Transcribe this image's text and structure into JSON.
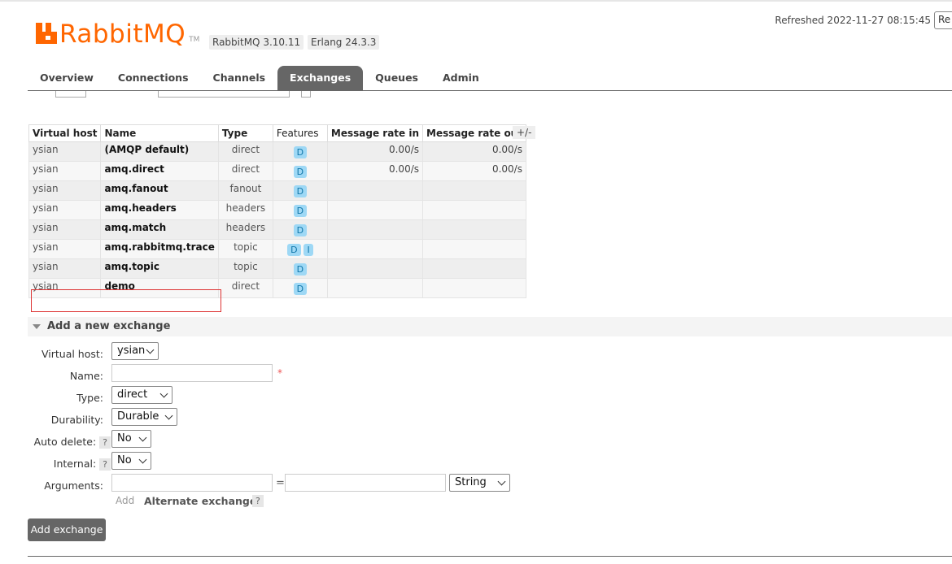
{
  "header": {
    "logo_text": "RabbitMQ",
    "logo_tm": "TM",
    "rabbitmq_version": "RabbitMQ 3.10.11",
    "erlang_version": "Erlang 24.3.3",
    "refreshed": "Refreshed 2022-11-27 08:15:45",
    "refresh_button": "Re",
    "brand_color": "#ff6600"
  },
  "tabs": [
    {
      "label": "Overview"
    },
    {
      "label": "Connections"
    },
    {
      "label": "Channels"
    },
    {
      "label": "Exchanges",
      "active": true
    },
    {
      "label": "Queues"
    },
    {
      "label": "Admin"
    }
  ],
  "table": {
    "columns": [
      "Virtual host",
      "Name",
      "Type",
      "Features",
      "Message rate in",
      "Message rate out"
    ],
    "toggle_columns": "+/-",
    "rows": [
      {
        "vhost": "ysian",
        "name": "(AMQP default)",
        "type": "direct",
        "features": [
          "D"
        ],
        "rate_in": "0.00/s",
        "rate_out": "0.00/s"
      },
      {
        "vhost": "ysian",
        "name": "amq.direct",
        "type": "direct",
        "features": [
          "D"
        ],
        "rate_in": "0.00/s",
        "rate_out": "0.00/s"
      },
      {
        "vhost": "ysian",
        "name": "amq.fanout",
        "type": "fanout",
        "features": [
          "D"
        ],
        "rate_in": "",
        "rate_out": ""
      },
      {
        "vhost": "ysian",
        "name": "amq.headers",
        "type": "headers",
        "features": [
          "D"
        ],
        "rate_in": "",
        "rate_out": ""
      },
      {
        "vhost": "ysian",
        "name": "amq.match",
        "type": "headers",
        "features": [
          "D"
        ],
        "rate_in": "",
        "rate_out": ""
      },
      {
        "vhost": "ysian",
        "name": "amq.rabbitmq.trace",
        "type": "topic",
        "features": [
          "D",
          "I"
        ],
        "rate_in": "",
        "rate_out": ""
      },
      {
        "vhost": "ysian",
        "name": "amq.topic",
        "type": "topic",
        "features": [
          "D"
        ],
        "rate_in": "",
        "rate_out": ""
      },
      {
        "vhost": "ysian",
        "name": "demo",
        "type": "direct",
        "features": [
          "D"
        ],
        "rate_in": "",
        "rate_out": ""
      }
    ]
  },
  "add_exchange": {
    "title": "Add a new exchange",
    "virtual_host_label": "Virtual host:",
    "virtual_host_value": "ysian",
    "name_label": "Name:",
    "name_value": "",
    "required_marker": "*",
    "type_label": "Type:",
    "type_value": "direct",
    "durability_label": "Durability:",
    "durability_value": "Durable",
    "auto_delete_label": "Auto delete:",
    "auto_delete_value": "No",
    "internal_label": "Internal:",
    "internal_value": "No",
    "arguments_label": "Arguments:",
    "arguments_eq": "=",
    "arguments_type": "String",
    "add_link": "Add",
    "alternate_exchange": "Alternate exchange",
    "help": "?",
    "submit": "Add exchange"
  }
}
